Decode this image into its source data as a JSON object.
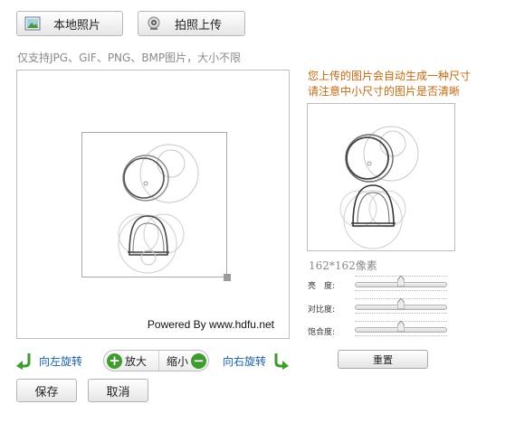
{
  "tabs": {
    "local_label": "本地照片",
    "camera_label": "拍照上传"
  },
  "support_note": "仅支持JPG、GIF、PNG、BMP图片，大小不限",
  "editor": {
    "powered_by": "Powered By www.hdfu.net"
  },
  "preview": {
    "hint_line1": "您上传的图片会自动生成一种尺寸",
    "hint_line2": "请注意中小尺寸的图片是否清晰",
    "size_label": "162*162像素"
  },
  "adjust": {
    "brightness_label": "亮　度:",
    "contrast_label": "对比度:",
    "saturation_label": "饱合度:",
    "brightness_level": 0.5,
    "contrast_level": 0.5,
    "saturation_level": 0.5,
    "reset_label": "重置"
  },
  "controls": {
    "rotate_left": "向左旋转",
    "rotate_right": "向右旋转",
    "zoom_in": "放大",
    "zoom_out": "缩小"
  },
  "actions": {
    "save": "保存",
    "cancel": "取消"
  },
  "colors": {
    "accent_green": "#3f9a2f",
    "link_blue": "#1b5fa6",
    "hint_orange": "#c06a10"
  }
}
